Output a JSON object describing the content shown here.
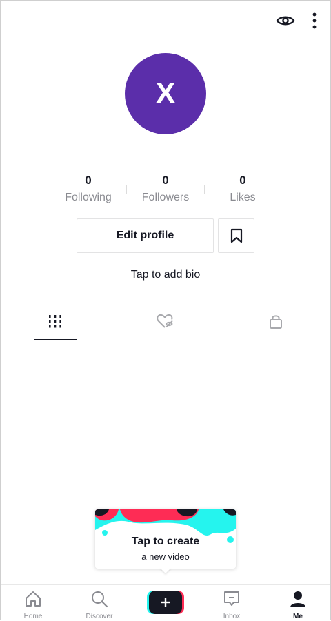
{
  "header": {
    "views_icon": "eye-icon",
    "more_icon": "more-vertical-icon"
  },
  "profile": {
    "avatar_initial": "X",
    "avatar_color": "#5b2eaa"
  },
  "stats": [
    {
      "count": "0",
      "label": "Following"
    },
    {
      "count": "0",
      "label": "Followers"
    },
    {
      "count": "0",
      "label": "Likes"
    }
  ],
  "actions": {
    "edit_profile_label": "Edit profile",
    "bookmark_icon": "bookmark-icon"
  },
  "bio": {
    "placeholder": "Tap to add bio"
  },
  "tabs": [
    {
      "icon": "videos-grid-icon",
      "active": true
    },
    {
      "icon": "liked-hidden-icon",
      "active": false
    },
    {
      "icon": "lock-icon",
      "active": false
    }
  ],
  "tooltip": {
    "title": "Tap to create",
    "subtitle": "a new video"
  },
  "bottom_nav": [
    {
      "icon": "home-icon",
      "label": "Home"
    },
    {
      "icon": "search-icon",
      "label": "Discover"
    },
    {
      "icon": "create-plus-icon",
      "label": ""
    },
    {
      "icon": "inbox-icon",
      "label": "Inbox"
    },
    {
      "icon": "profile-icon",
      "label": "Me",
      "active": true
    }
  ],
  "colors": {
    "text_primary": "#161823",
    "text_secondary": "#8a8b91",
    "accent_pink": "#fe2c55",
    "accent_cyan": "#25f4ee"
  }
}
